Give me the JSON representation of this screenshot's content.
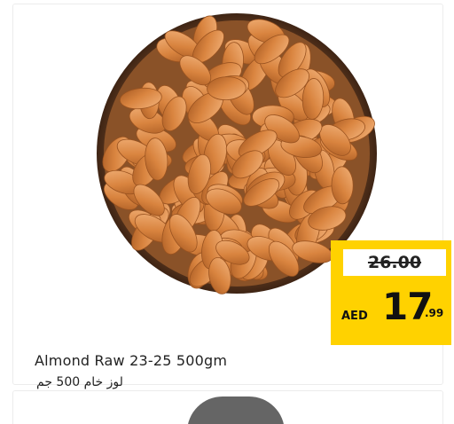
{
  "product": {
    "name_en": "Almond Raw 23-25 500gm",
    "name_ar": "لوز خام 500 جم",
    "image_icon": "almond-bowl-image"
  },
  "price": {
    "old": "26.00",
    "currency": "AED",
    "integer": "17",
    "decimal": ".99"
  },
  "colors": {
    "tag_yellow": "#ffd200",
    "almond": "#d98a4a",
    "bowl": "#5a3a22"
  }
}
